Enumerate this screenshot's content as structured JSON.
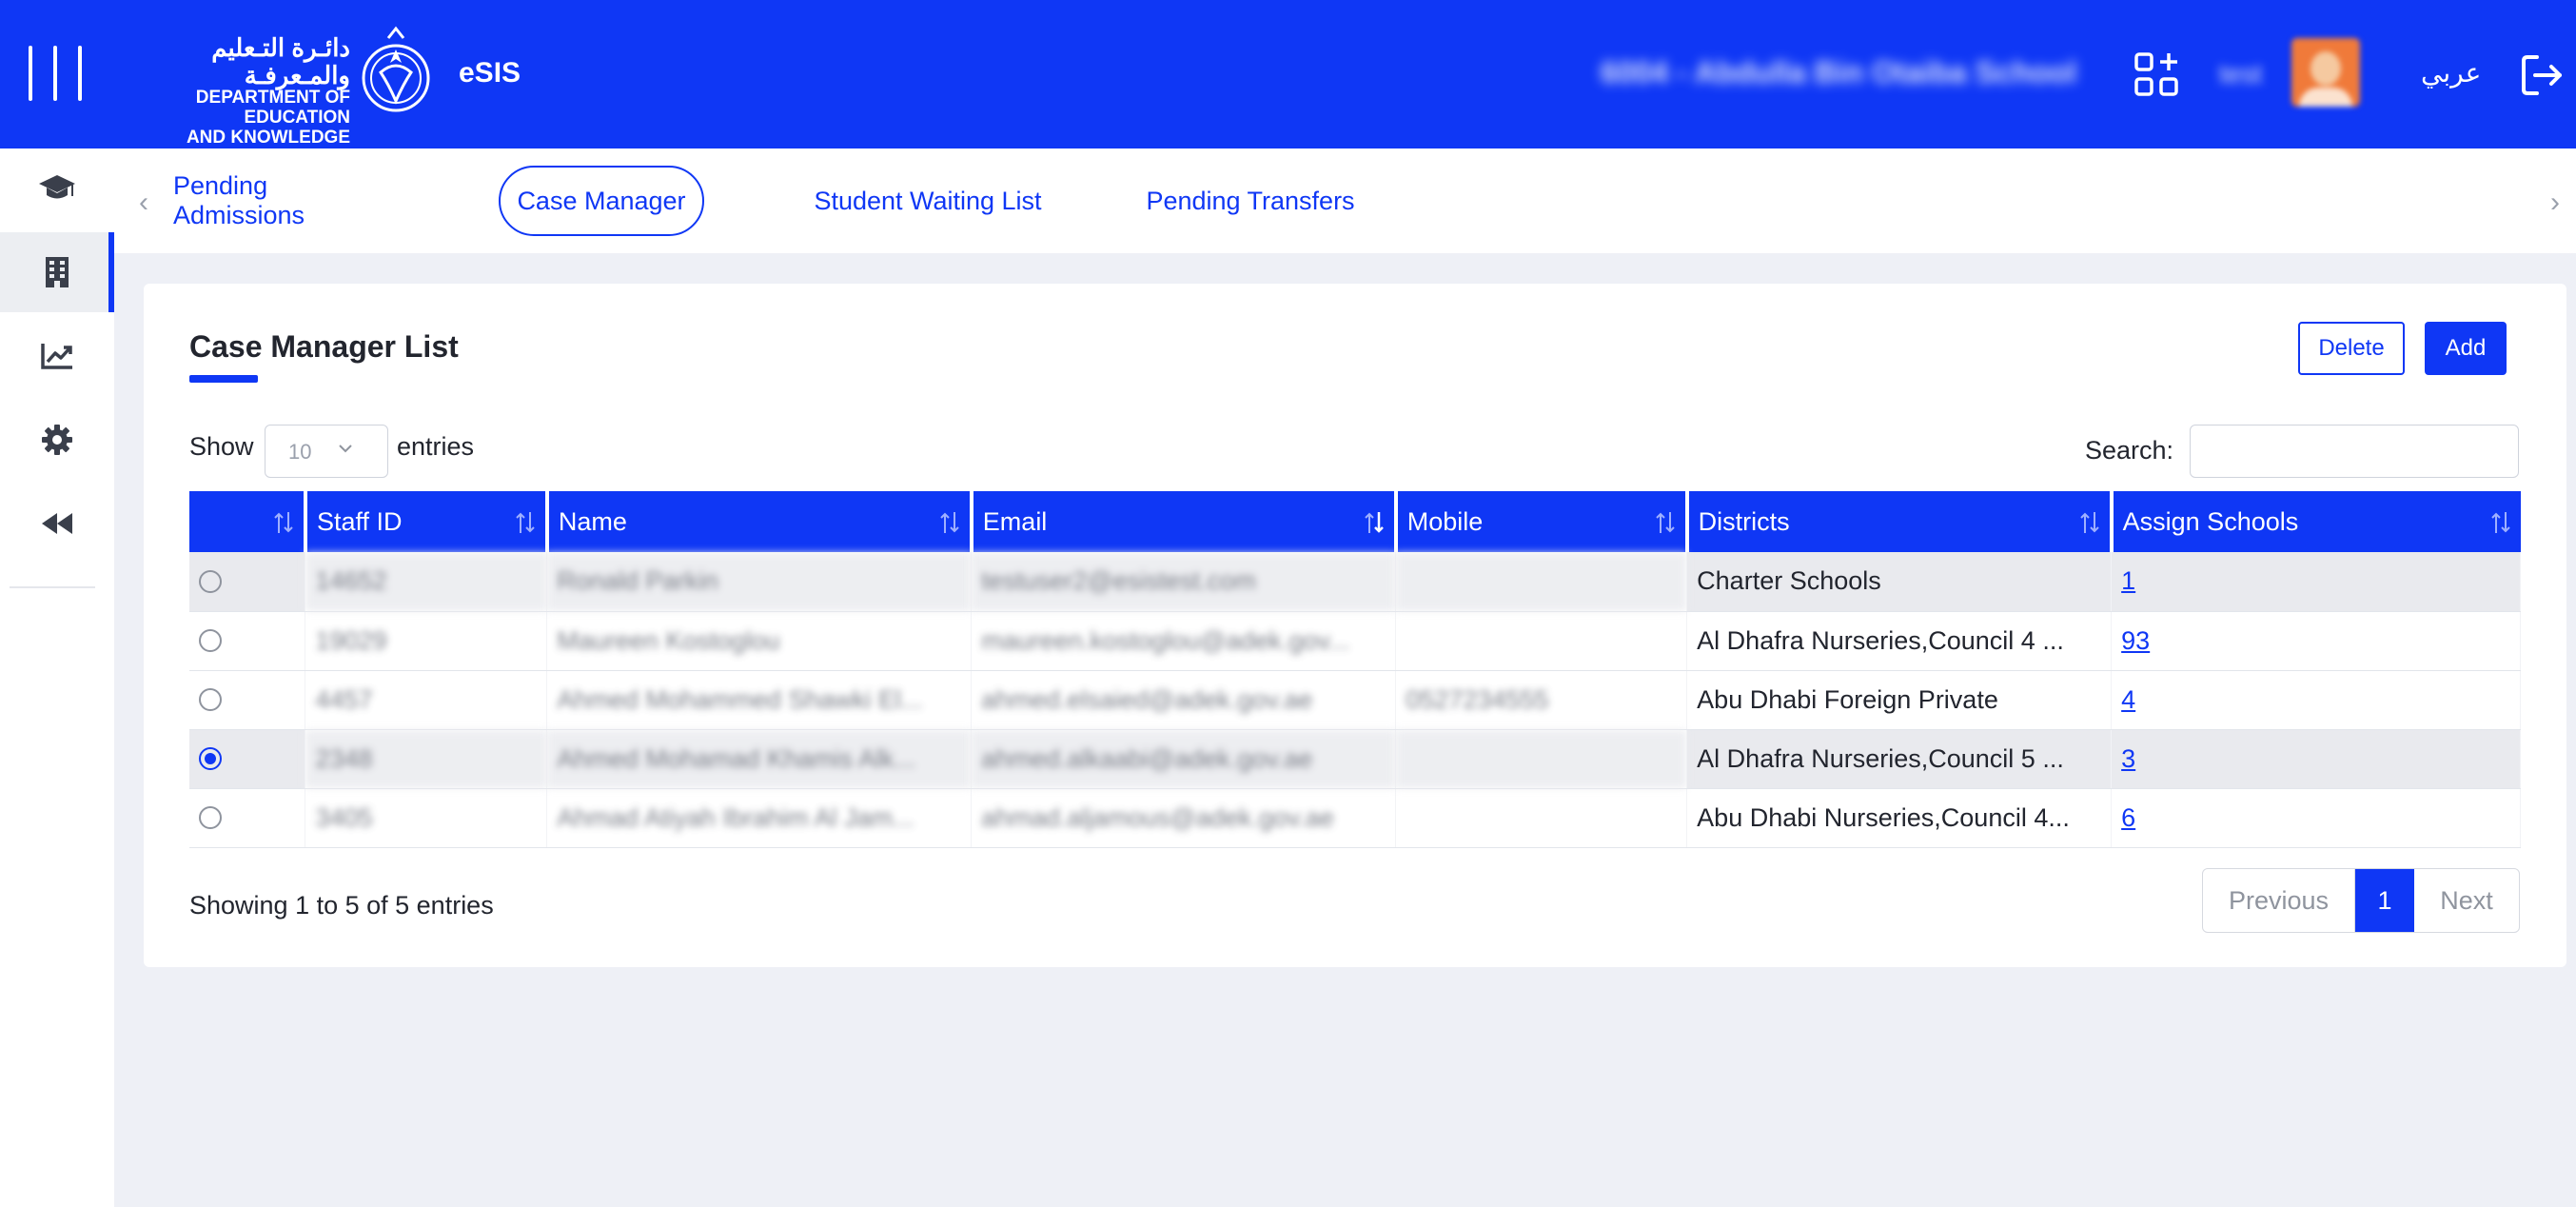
{
  "header": {
    "logo_ar": "دائـرة التـعليم والمـعرفـة",
    "logo_en_line1": "DEPARTMENT OF EDUCATION",
    "logo_en_line2": "AND KNOWLEDGE",
    "app_name": "eSIS",
    "school_name": "6004 - Abdulla Bin Otaiba School",
    "user_name": "test",
    "language_toggle": "عربي"
  },
  "tabs": [
    {
      "label": "Pending Admissions"
    },
    {
      "label": "Case Manager"
    },
    {
      "label": "Student Waiting List"
    },
    {
      "label": "Pending Transfers"
    }
  ],
  "card": {
    "title": "Case Manager List",
    "delete_label": "Delete",
    "add_label": "Add",
    "show_label": "Show",
    "entries_select_value": "10",
    "entries_label": "entries",
    "search_label": "Search:",
    "search_value": ""
  },
  "table": {
    "columns": [
      "",
      "Staff ID",
      "Name",
      "Email",
      "Mobile",
      "Districts",
      "Assign Schools"
    ],
    "rows": [
      {
        "staff_id": "14652",
        "name": "Ronald Parkin",
        "email": "testuser2@esistest.com",
        "mobile": "",
        "districts": "Charter Schools",
        "assign": "1",
        "selected": false
      },
      {
        "staff_id": "19029",
        "name": "Maureen Kostoglou",
        "email": "maureen.kostoglou@adek.gov...",
        "mobile": "",
        "districts": "Al Dhafra Nurseries,Council 4 ...",
        "assign": "93",
        "selected": false
      },
      {
        "staff_id": "4457",
        "name": "Ahmed Mohammed Shawki El...",
        "email": "ahmed.elsaied@adek.gov.ae",
        "mobile": "0527234555",
        "districts": "Abu Dhabi Foreign Private",
        "assign": "4",
        "selected": false
      },
      {
        "staff_id": "2348",
        "name": "Ahmed Mohamad Khamis Alk...",
        "email": "ahmed.alkaabi@adek.gov.ae",
        "mobile": "",
        "districts": "Al Dhafra Nurseries,Council 5 ...",
        "assign": "3",
        "selected": true
      },
      {
        "staff_id": "3405",
        "name": "Ahmad Atiyah Ibrahim Al Jam...",
        "email": "ahmad.aljamous@adek.gov.ae",
        "mobile": "",
        "districts": "Abu Dhabi Nurseries,Council 4...",
        "assign": "6",
        "selected": false
      }
    ]
  },
  "footer": {
    "info": "Showing 1 to 5 of 5 entries",
    "previous": "Previous",
    "current_page": "1",
    "next": "Next"
  },
  "colors": {
    "brand_blue": "#0f37f5",
    "page_background": "#eef0f6"
  },
  "icons": {
    "sidebar": [
      "graduation-cap-icon",
      "building-icon",
      "chart-line-icon",
      "gear-icon",
      "backward-icon"
    ]
  }
}
